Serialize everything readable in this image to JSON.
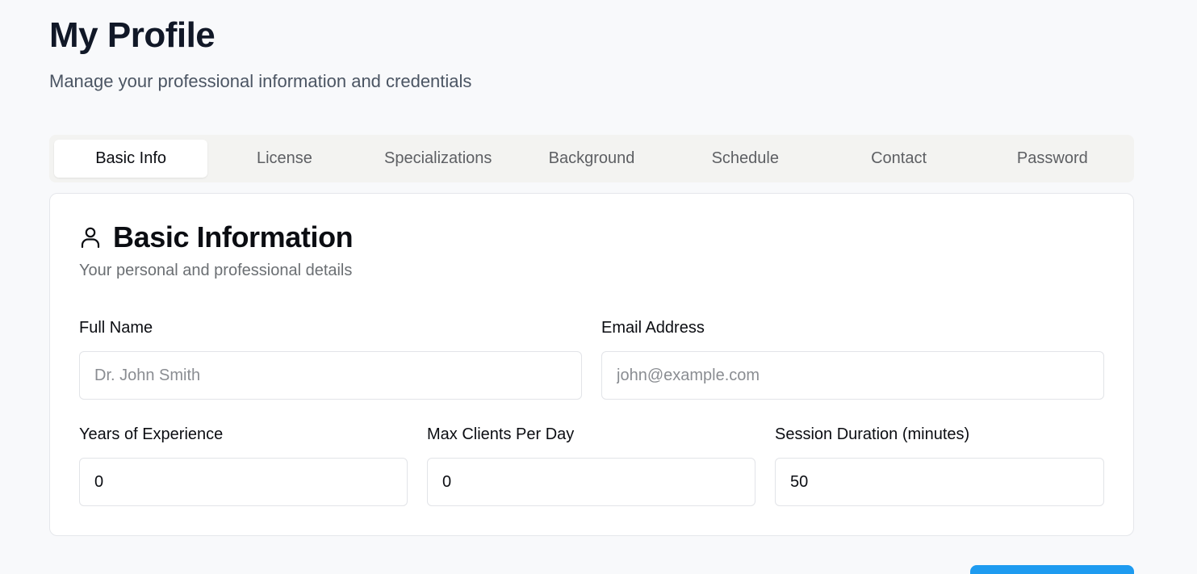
{
  "header": {
    "title": "My Profile",
    "subtitle": "Manage your professional information and credentials"
  },
  "tabs": [
    {
      "label": "Basic Info",
      "active": true
    },
    {
      "label": "License",
      "active": false
    },
    {
      "label": "Specializations",
      "active": false
    },
    {
      "label": "Background",
      "active": false
    },
    {
      "label": "Schedule",
      "active": false
    },
    {
      "label": "Contact",
      "active": false
    },
    {
      "label": "Password",
      "active": false
    }
  ],
  "card": {
    "icon": "user-icon",
    "title": "Basic Information",
    "description": "Your personal and professional details"
  },
  "fields": {
    "full_name": {
      "label": "Full Name",
      "value": "",
      "placeholder": "Dr. John Smith"
    },
    "email": {
      "label": "Email Address",
      "value": "",
      "placeholder": "john@example.com"
    },
    "years_experience": {
      "label": "Years of Experience",
      "value": "0",
      "placeholder": ""
    },
    "max_clients": {
      "label": "Max Clients Per Day",
      "value": "0",
      "placeholder": ""
    },
    "session_duration": {
      "label": "Session Duration (minutes)",
      "value": "50",
      "placeholder": ""
    }
  },
  "colors": {
    "accent": "#1e9bf0",
    "background": "#f8f9fb",
    "tab_bar": "#f3f3f1"
  }
}
